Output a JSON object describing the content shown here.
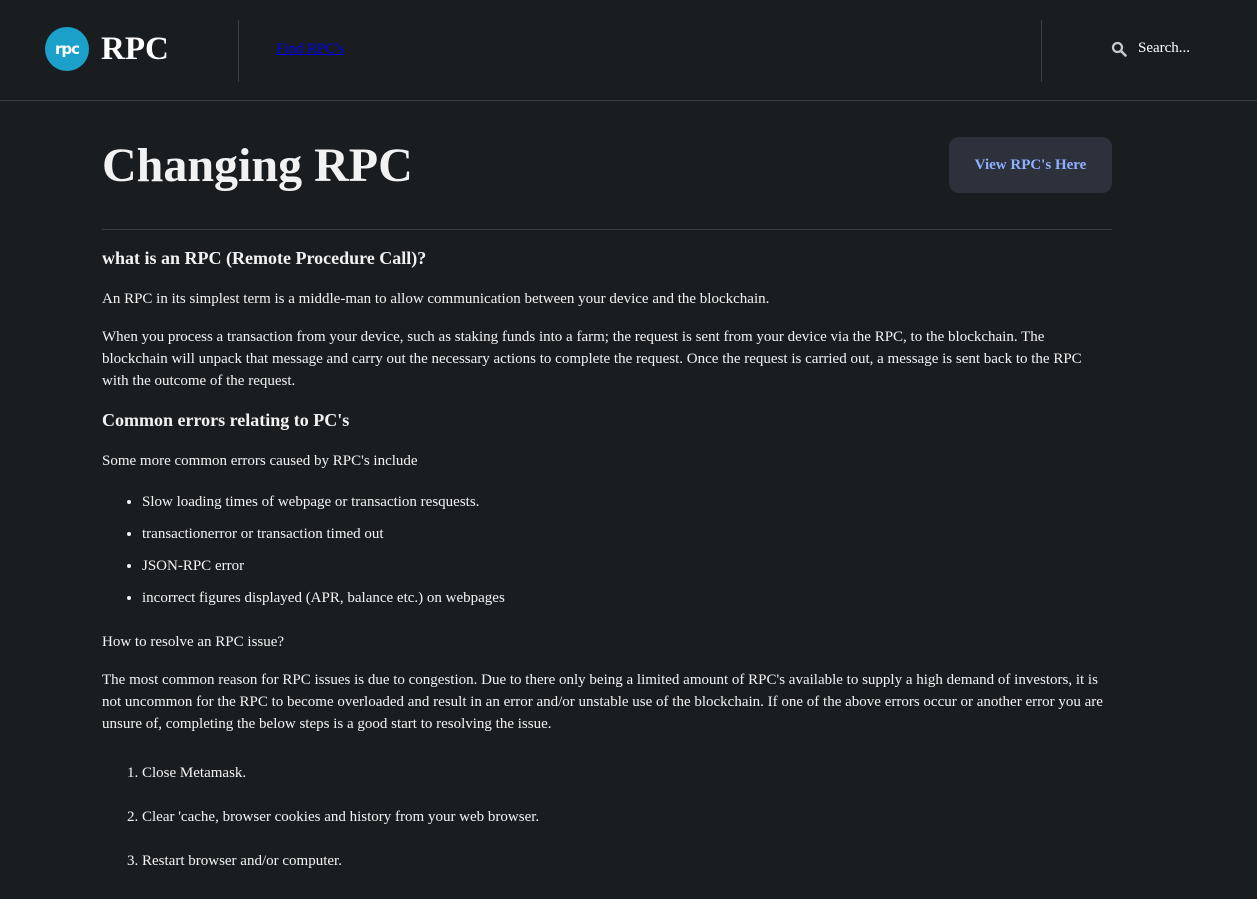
{
  "header": {
    "logo_mark": "rpc",
    "logo_text": "RPC",
    "nav_link": "Find RPC's",
    "search_placeholder": "Search..."
  },
  "main": {
    "title": "Changing RPC",
    "cta_label": "View RPC's Here",
    "section1": {
      "heading": "what is an RPC (Remote Procedure Call)?",
      "paragraphs": [
        "An RPC in its simplest term is a middle-man to allow communication between your device and the blockchain.",
        "When you process a transaction from your device, such as staking funds into a farm; the request is sent from your device via the RPC, to the blockchain. The blockchain will unpack that message and carry out the necessary actions to complete the request. Once the request is carried out, a message is sent back to the RPC with the outcome of the request."
      ]
    },
    "section2": {
      "heading": "Common errors relating to PC's",
      "intro": "Some more common errors caused by RPC's include",
      "errors": [
        "Slow loading times of webpage or transaction resquests.",
        "transactionerror or transaction timed out",
        "JSON-RPC error",
        "incorrect figures displayed (APR, balance etc.) on webpages"
      ]
    },
    "section3": {
      "heading": "How to resolve an RPC issue?",
      "paragraph": "The most common reason for RPC issues is due to congestion. Due to there only being a limited amount of RPC's available to supply a high demand of investors, it is not uncommon for the RPC to become overloaded and result in an error and/or unstable use of the blockchain. If one of the above errors occur or another error you are unsure of, completing the below steps is a good start to resolving the issue.",
      "steps": [
        "Close Metamask.",
        "Clear 'cache, browser cookies and history from your web browser.",
        "Restart browser and/or computer."
      ]
    }
  },
  "colors": {
    "background": "#1a1d20",
    "logo_accent": "#1ba1c9",
    "button_bg": "#2c313b",
    "button_text": "#8fb0ff",
    "link": "#0000ee"
  }
}
